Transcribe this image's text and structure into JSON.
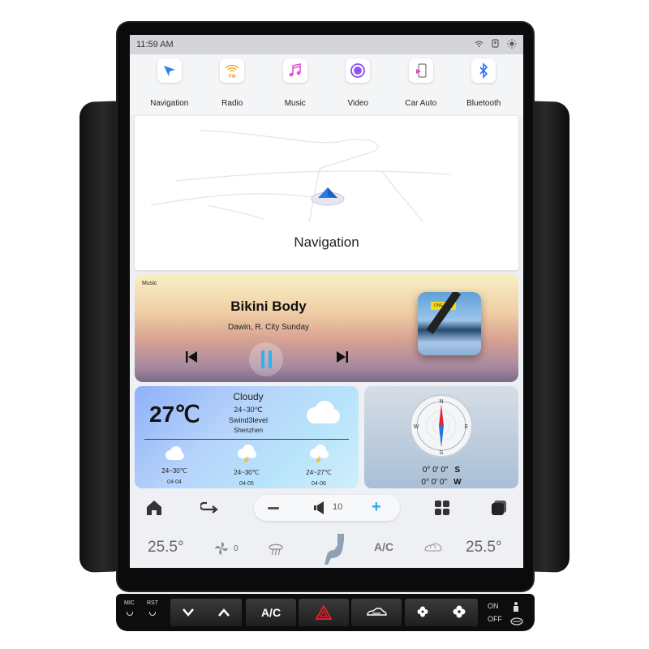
{
  "status_bar": {
    "time": "11:59 AM",
    "icons": [
      "wifi-icon",
      "phone-icon",
      "brightness-icon"
    ]
  },
  "apps": [
    {
      "label": "Navigation",
      "icon": "navigation-arrow-icon",
      "color": "#2f7df0"
    },
    {
      "label": "Radio",
      "icon": "fm-radio-icon",
      "icon_text": "FM",
      "color": "#f0a020"
    },
    {
      "label": "Music",
      "icon": "music-note-icon",
      "color": "#e54fd6"
    },
    {
      "label": "Video",
      "icon": "play-circle-icon",
      "color": "#8a4ff0"
    },
    {
      "label": "Car Auto",
      "icon": "car-auto-phone-icon",
      "color": "#e53fd6"
    },
    {
      "label": "Bluetooth",
      "icon": "bluetooth-icon",
      "color": "#2f6df0"
    }
  ],
  "navigation_card": {
    "title": "Navigation"
  },
  "music_card": {
    "tag": "Music",
    "song": "Bikini Body",
    "artist": "Dawin, R. City  Sunday",
    "album_sign": "ONE TILE",
    "play_color": "#2bb3ee"
  },
  "weather_card": {
    "temperature": "27℃",
    "condition": "Cloudy",
    "range": "24~30℃",
    "wind": "Swind3level",
    "city": "Shenzhen",
    "forecast": [
      {
        "icon": "cloud-icon",
        "range": "24~30℃",
        "date": "04-04"
      },
      {
        "icon": "thunderstorm-icon",
        "range": "24~30℃",
        "date": "04-05"
      },
      {
        "icon": "thunderstorm-icon",
        "range": "24~27℃",
        "date": "04-06"
      }
    ]
  },
  "compass_card": {
    "latitude": "0° 0' 0\"",
    "latitude_dir": "S",
    "longitude": "0° 0' 0\"",
    "longitude_dir": "W",
    "dial_labels": [
      "N",
      "E",
      "S",
      "W"
    ]
  },
  "dock": {
    "volume": "10",
    "buttons": [
      "home-icon",
      "back-icon",
      "volume-down",
      "volume-up",
      "apps-grid-icon",
      "recent-apps-icon"
    ]
  },
  "climate": {
    "left_temp": "25.5°",
    "right_temp": "25.5°",
    "fan_speed": "0",
    "ac_label": "A/C"
  },
  "hardware_panel": {
    "mic_label": "MIC",
    "rst_label": "RST",
    "ac_label": "A/C",
    "on_label": "ON",
    "off_label": "OFF"
  }
}
